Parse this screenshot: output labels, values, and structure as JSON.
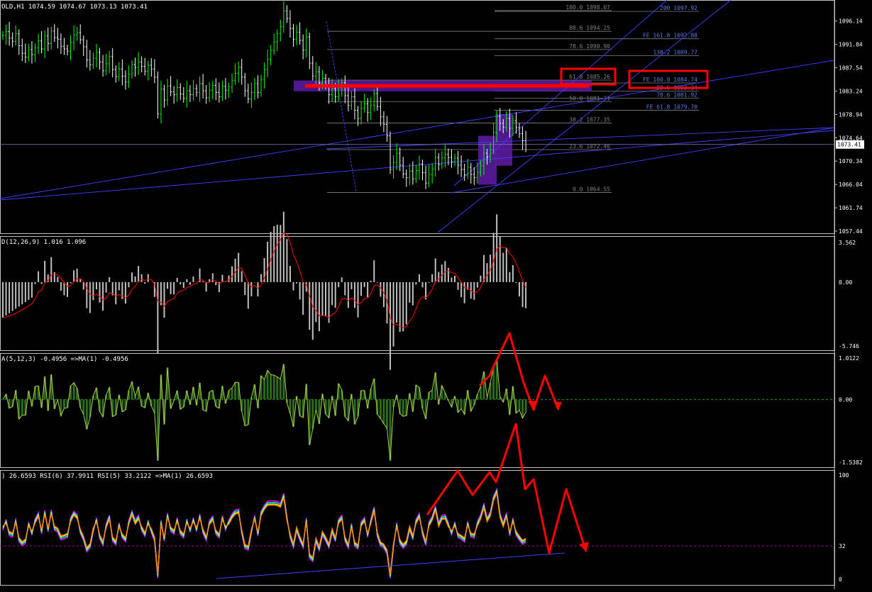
{
  "colors": {
    "background": "#000000",
    "panel_border": "#c0c0c0",
    "bull_candle": "#00ff00",
    "bear_candle": "#ffffff",
    "fib": "#808080",
    "fib_text": "#808080",
    "fe_text": "#5a7be8",
    "trend": "#4040ff",
    "zone": "#5a1a9c",
    "annotation": "#ff0000",
    "hist": "#c0c0c0",
    "signal": "#ff0000",
    "osma": "#2e6b1f",
    "osma_line": "#b0d040",
    "rsi_slow": "#ff00ff",
    "rsi_mid": "#00ffff",
    "rsi_fast": "#ffff00",
    "rsi_ma": "#ff8000",
    "level_dash": "#00a000",
    "level_dash_rsi": "#a000a0",
    "price_box": "#ffffff"
  },
  "price_panel": {
    "title": "OLD,H1  1074.59 1074.67 1073.13 1073.41",
    "current_price": "1073.41",
    "axis_labels": [
      "1096.14",
      "1091.84",
      "1087.54",
      "1083.24",
      "1078.94",
      "1074.64",
      "1070.34",
      "1066.04",
      "1061.74",
      "1057.44"
    ],
    "fib_levels": [
      {
        "label": "100.0  1098.07"
      },
      {
        "label": "88.6  1094.25"
      },
      {
        "label": "78.6  1090.90"
      },
      {
        "label": "61.8  1085.26"
      },
      {
        "label": "50.0  1081.31"
      },
      {
        "label": "38.2  1077.35"
      },
      {
        "label": "23.6  1072.46"
      },
      {
        "label": "0.0  1064.55"
      }
    ],
    "fe_levels": [
      {
        "label": "200  1097.92"
      },
      {
        "label": "FE 161.8  1092.88"
      },
      {
        "label": "138.2  1089.77"
      },
      {
        "label": "FE 100.0  1084.74"
      },
      {
        "label": "88.6  1083.24"
      },
      {
        "label": "78.6  1081.92"
      },
      {
        "label": "FE 61.8  1079.70"
      }
    ]
  },
  "macd_panel": {
    "title": "D(12,26,9) 1.016 1.096",
    "axis_labels": [
      "3.562",
      "0.00",
      "-5.746"
    ]
  },
  "osma_panel": {
    "title": "A(5,12,3) -0.4956  =>MA(1) -0.4956",
    "axis_labels": [
      "1.0122",
      "0.00",
      "-1.5382"
    ]
  },
  "rsi_panel": {
    "title": ") 26.6593  RSI(6) 37.9911  RSI(5) 33.2122  =>MA(1) 26.6593",
    "axis_labels": [
      "100",
      "32",
      "0"
    ]
  },
  "chart_data": {
    "type": "line",
    "title": "OLD,H1",
    "ohlc_last": {
      "open": 1074.59,
      "high": 1074.67,
      "low": 1073.13,
      "close": 1073.41
    },
    "ylim": [
      1057.44,
      1099.5
    ],
    "close": [
      1093.5,
      1094.2,
      1093.0,
      1092.4,
      1093.8,
      1091.6,
      1090.2,
      1089.5,
      1090.9,
      1090.0,
      1091.2,
      1092.5,
      1091.0,
      1093.4,
      1092.0,
      1094.3,
      1093.1,
      1092.8,
      1091.5,
      1091.0,
      1090.6,
      1092.2,
      1093.6,
      1094.0,
      1092.7,
      1091.4,
      1089.0,
      1088.1,
      1089.3,
      1090.4,
      1088.6,
      1087.0,
      1088.3,
      1089.6,
      1087.2,
      1085.9,
      1087.3,
      1086.0,
      1084.9,
      1086.4,
      1088.1,
      1087.6,
      1088.6,
      1087.8,
      1086.9,
      1088.0,
      1087.3,
      1085.8,
      1079.0,
      1083.6,
      1081.6,
      1084.2,
      1083.1,
      1082.6,
      1083.9,
      1082.7,
      1081.9,
      1083.3,
      1082.6,
      1083.7,
      1083.0,
      1084.6,
      1083.3,
      1082.0,
      1083.4,
      1084.3,
      1083.0,
      1082.2,
      1084.1,
      1083.4,
      1084.0,
      1085.2,
      1086.5,
      1087.6,
      1085.8,
      1083.3,
      1081.8,
      1083.0,
      1084.6,
      1083.0,
      1085.4,
      1087.2,
      1089.1,
      1090.7,
      1092.3,
      1093.8,
      1095.1,
      1098.0,
      1096.6,
      1094.8,
      1092.8,
      1094.1,
      1092.6,
      1090.8,
      1093.2,
      1088.4,
      1086.0,
      1086.8,
      1084.7,
      1085.6,
      1084.4,
      1082.6,
      1083.7,
      1082.2,
      1083.9,
      1084.8,
      1082.4,
      1080.6,
      1082.2,
      1079.7,
      1078.2,
      1080.1,
      1080.9,
      1079.3,
      1080.6,
      1082.8,
      1080.4,
      1078.5,
      1077.1,
      1075.0,
      1068.8,
      1070.1,
      1071.8,
      1069.6,
      1068.0,
      1067.3,
      1068.5,
      1067.1,
      1068.6,
      1069.8,
      1068.2,
      1066.3,
      1067.9,
      1068.9,
      1071.0,
      1069.7,
      1070.9,
      1071.6,
      1071.0,
      1070.2,
      1070.9,
      1069.6,
      1068.8,
      1067.8,
      1069.2,
      1067.9,
      1067.3,
      1068.3,
      1069.5,
      1071.8,
      1071.1,
      1072.4,
      1075.6,
      1078.6,
      1077.3,
      1076.6,
      1078.2,
      1076.4,
      1077.8,
      1076.5,
      1075.4,
      1074.1,
      1073.4
    ],
    "fib_retracement": {
      "levels": [
        100.0,
        88.6,
        78.6,
        61.8,
        50.0,
        38.2,
        23.6,
        0.0
      ],
      "prices": [
        1098.07,
        1094.25,
        1090.9,
        1085.26,
        1081.31,
        1077.35,
        1072.46,
        1064.55
      ]
    },
    "fib_expansion": {
      "levels": [
        200,
        161.8,
        138.2,
        100.0,
        88.6,
        78.6,
        61.8
      ],
      "prices": [
        1097.92,
        1092.88,
        1089.77,
        1084.74,
        1083.24,
        1081.92,
        1079.7
      ]
    },
    "indicators": {
      "macd": {
        "params": "12,26,9",
        "main": 1.016,
        "signal": 1.096,
        "ylim": [
          -5.746,
          3.562
        ]
      },
      "osma": {
        "params": "5,12,3",
        "value": -0.4956,
        "ma1": -0.4956,
        "ylim": [
          -1.5382,
          1.0122
        ]
      },
      "rsi": {
        "values": {
          "RSI(6)": 37.9911,
          "RSI(5)": 33.2122
        },
        "ma1": 26.6593,
        "levels": [
          100,
          32,
          0
        ]
      }
    }
  }
}
